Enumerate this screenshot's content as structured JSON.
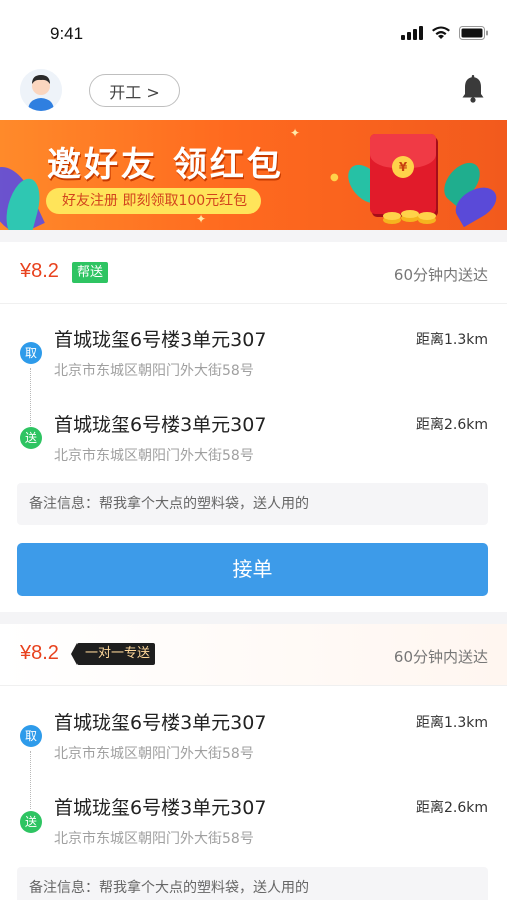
{
  "status_bar": {
    "time": "9:41"
  },
  "top_bar": {
    "shift_button_label": "开工 >"
  },
  "banner": {
    "title": "邀好友 领红包",
    "subtitle": "好友注册 即刻领取100元红包",
    "coin_symbol": "¥"
  },
  "orders": [
    {
      "price": "¥8.2",
      "tag": "帮送",
      "eta": "60分钟内送达",
      "pickup": {
        "badge": "取",
        "name": "首城珑玺6号楼3单元307",
        "address": "北京市东城区朝阳门外大街58号",
        "distance": "距离1.3km"
      },
      "dropoff": {
        "badge": "送",
        "name": "首城珑玺6号楼3单元307",
        "address": "北京市东城区朝阳门外大街58号",
        "distance": "距离2.6km"
      },
      "note": "备注信息：帮我拿个大点的塑料袋，送人用的",
      "accept_label": "接单"
    },
    {
      "price": "¥8.2",
      "tag": "一对一专送",
      "eta": "60分钟内送达",
      "pickup": {
        "badge": "取",
        "name": "首城珑玺6号楼3单元307",
        "address": "北京市东城区朝阳门外大街58号",
        "distance": "距离1.3km"
      },
      "dropoff": {
        "badge": "送",
        "name": "首城珑玺6号楼3单元307",
        "address": "北京市东城区朝阳门外大街58号",
        "distance": "距离2.6km"
      },
      "note": "备注信息：帮我拿个大点的塑料袋，送人用的"
    }
  ],
  "colors": {
    "accent_blue": "#3d9be9",
    "price_red": "#e8421e",
    "help_tag_green": "#2ec462",
    "banner_orange": "#ff6a1f"
  },
  "icons": [
    "signal-icon",
    "wifi-icon",
    "battery-icon",
    "avatar",
    "bell-icon",
    "red-envelope-icon"
  ]
}
